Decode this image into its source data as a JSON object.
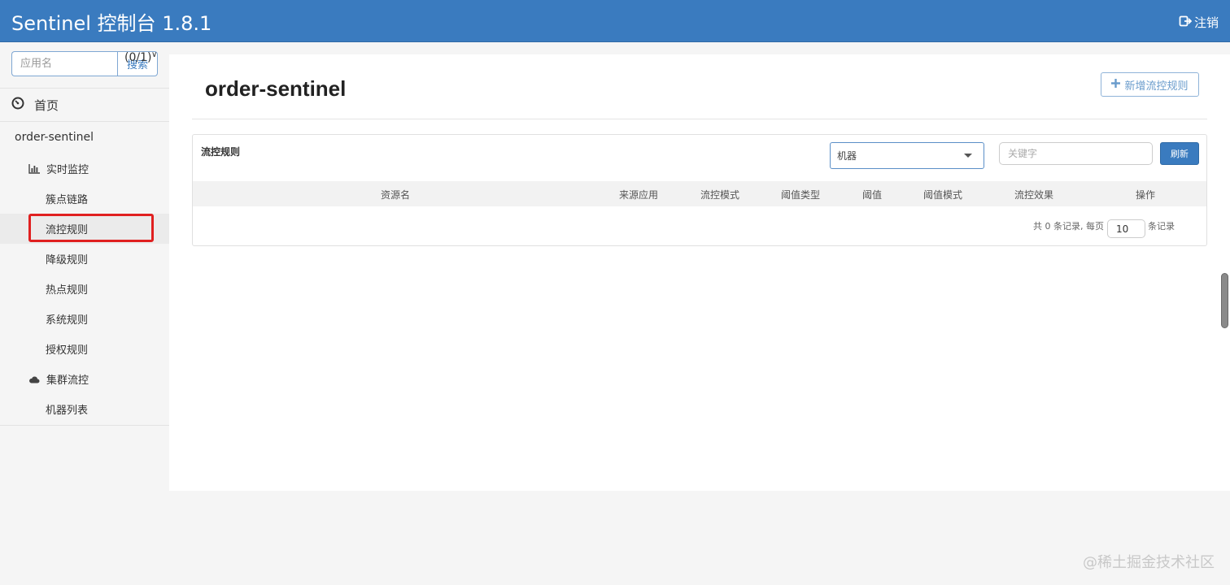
{
  "header": {
    "title": "Sentinel 控制台 1.8.1",
    "logout_label": "注销",
    "logout_icon": "sign-out-icon",
    "bg_color": "#3a7bbf"
  },
  "sidebar": {
    "search_placeholder": "应用名",
    "search_button": "搜索",
    "home": {
      "label": "首页",
      "icon": "dashboard-icon"
    },
    "app": {
      "name": "order-sentinel",
      "count": "(0/1)",
      "icon": "chevron-down-icon"
    },
    "items": [
      {
        "label": "实时监控",
        "icon": "bar-chart-icon"
      },
      {
        "label": "簇点链路"
      },
      {
        "label": "流控规则"
      },
      {
        "label": "降级规则"
      },
      {
        "label": "热点规则"
      },
      {
        "label": "系统规则"
      },
      {
        "label": "授权规则"
      },
      {
        "label": "集群流控",
        "icon": "cloud-icon"
      },
      {
        "label": "机器列表"
      }
    ],
    "active_item": "流控规则",
    "highlight_color": "#e02020"
  },
  "main": {
    "title": "order-sentinel",
    "add_button": "新增流控规则",
    "add_icon": "plus-icon",
    "panel": {
      "title": "流控规则",
      "machine_select": "机器",
      "keyword_placeholder": "关键字",
      "refresh_button": "刷新",
      "columns": [
        "资源名",
        "来源应用",
        "流控模式",
        "阈值类型",
        "阈值",
        "阈值模式",
        "流控效果",
        "操作"
      ],
      "rows": [],
      "pager": {
        "prefix": "共 0 条记录, 每页",
        "page_size": "10",
        "suffix": "条记录"
      }
    }
  },
  "watermark": "@稀土掘金技术社区"
}
